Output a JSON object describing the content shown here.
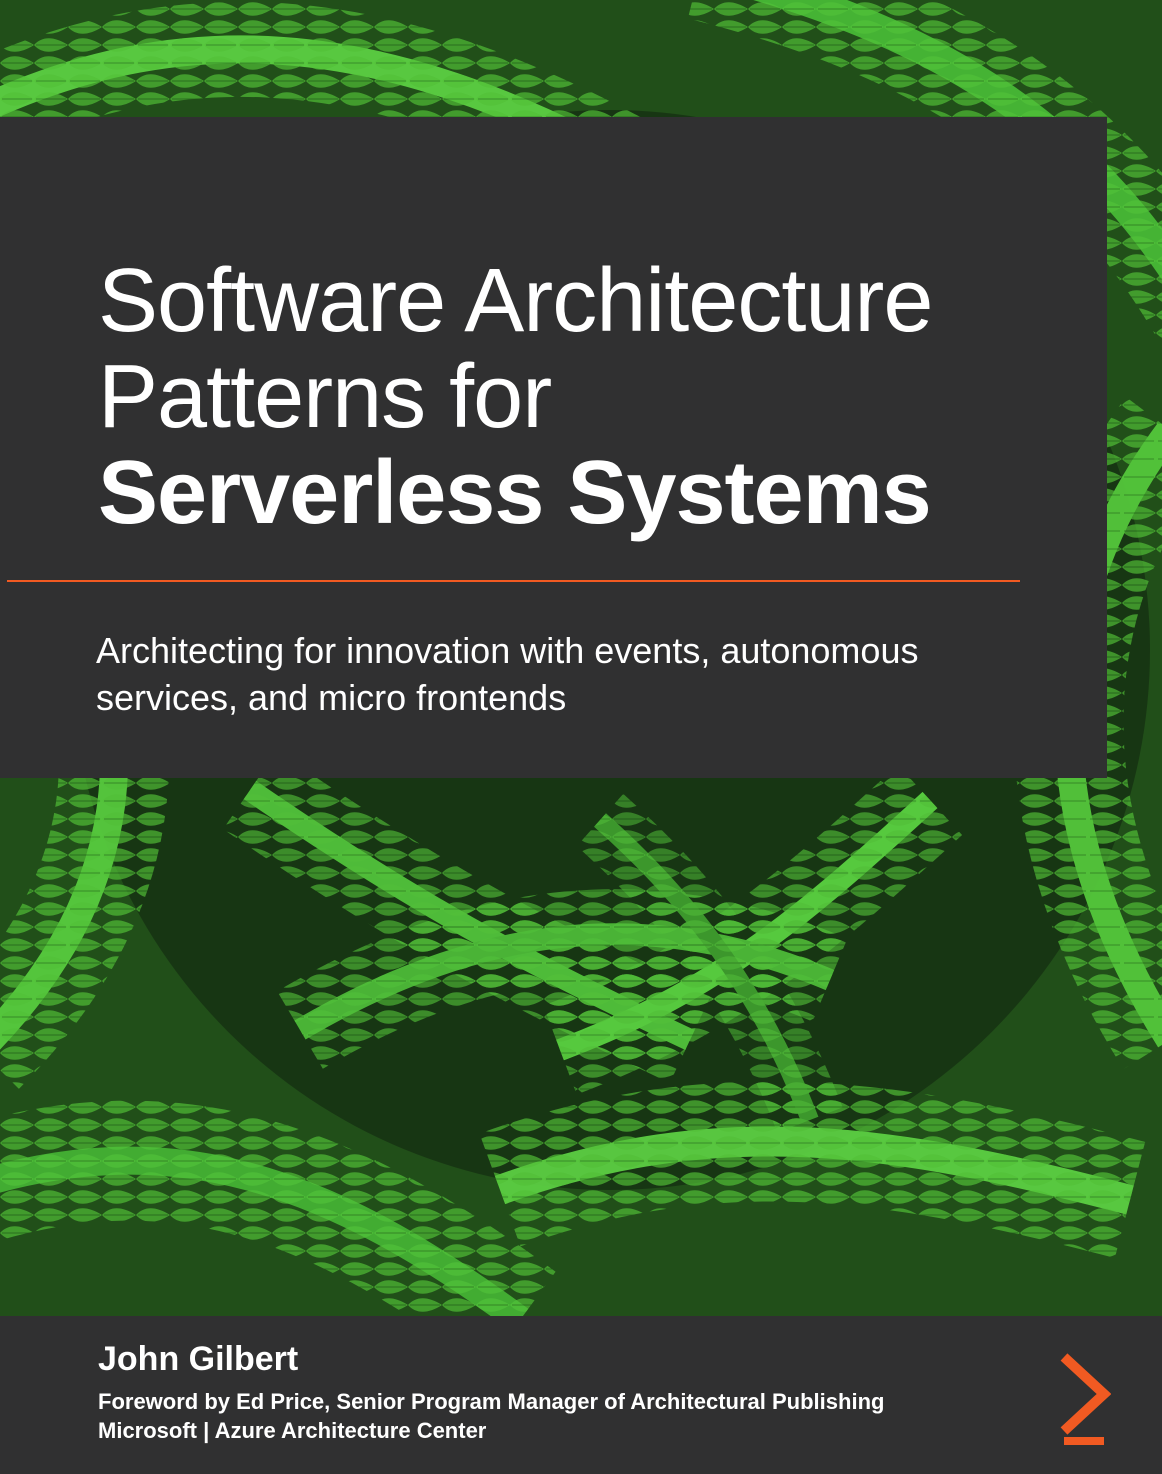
{
  "book": {
    "title_line_1": "Software Architecture",
    "title_line_2": "Patterns for",
    "title_line_3": "Serverless Systems",
    "subtitle_line_1": "Architecting for innovation with events, autonomous",
    "subtitle_line_2": "services, and micro frontends",
    "author": "John Gilbert",
    "foreword_line_1": "Foreword by Ed Price, Senior Program Manager of Architectural Publishing",
    "foreword_line_2": "Microsoft | Azure Architecture Center"
  },
  "colors": {
    "panel": "#303031",
    "text": "#ffffff",
    "accent": "#f15a22",
    "fern_light": "#54c63b",
    "fern_mid": "#2f8a25",
    "fern_dark": "#10230e"
  },
  "icons": {
    "publisher_mark": "orange-chevron-icon"
  }
}
